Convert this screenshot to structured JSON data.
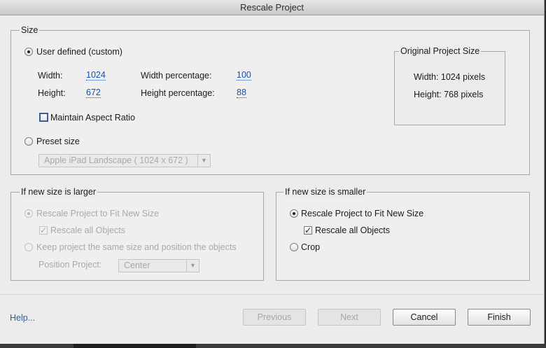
{
  "window": {
    "title": "Rescale Project"
  },
  "size": {
    "legend": "Size",
    "user_defined_label": "User defined (custom)",
    "width_label": "Width:",
    "width_value": "1024",
    "height_label": "Height:",
    "height_value": "672",
    "width_pct_label": "Width percentage:",
    "width_pct_value": "100",
    "height_pct_label": "Height percentage:",
    "height_pct_value": "88",
    "aspect_label": "Maintain Aspect Ratio",
    "preset_label": "Preset size",
    "preset_selected": "Apple iPad Landscape ( 1024 x 672 )",
    "original": {
      "legend": "Original Project Size",
      "width_text": "Width: 1024 pixels",
      "height_text": "Height: 768 pixels"
    }
  },
  "larger": {
    "legend": "If new size is larger",
    "rescale_label": "Rescale Project to Fit New Size",
    "rescale_all_label": "Rescale all Objects",
    "keep_label": "Keep project the same size and position the objects",
    "position_label": "Position Project:",
    "position_selected": "Center"
  },
  "smaller": {
    "legend": "If new size is smaller",
    "rescale_label": "Rescale Project to Fit New Size",
    "rescale_all_label": "Rescale all Objects",
    "crop_label": "Crop"
  },
  "footer": {
    "help_label": "Help...",
    "previous_label": "Previous",
    "next_label": "Next",
    "cancel_label": "Cancel",
    "finish_label": "Finish"
  },
  "glyphs": {
    "check": "✓",
    "dropdown_arrow": "▼"
  }
}
